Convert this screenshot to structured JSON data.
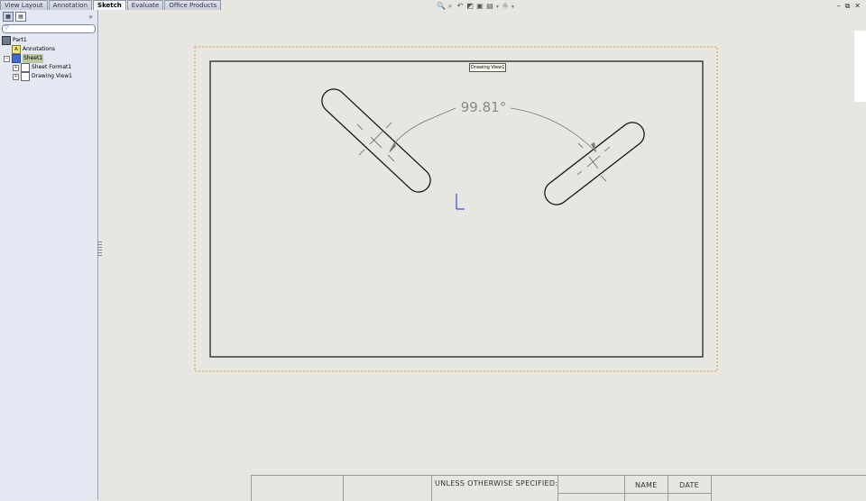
{
  "tabs": [
    "View Layout",
    "Annotation",
    "Sketch",
    "Evaluate",
    "Office Products"
  ],
  "active_tab": "Sketch",
  "view_toolbar_icons": [
    "zoom-to-fit-icon",
    "zoom-area-icon",
    "previous-view-icon",
    "section-view-icon",
    "view-orientation-icon",
    "display-style-icon",
    "hide-show-icon"
  ],
  "tree": {
    "root": "Part1",
    "annotations": "Annotations",
    "sheet": "Sheet1",
    "sheet_format": "Sheet Format1",
    "drawing_view": "Drawing View1"
  },
  "drawing": {
    "view_label": "Drawing View1",
    "angle_dimension": "99.81°"
  },
  "title_block": {
    "unless": "UNLESS OTHERWISE SPECIFIED:",
    "name": "NAME",
    "date": "DATE"
  },
  "colors": {
    "canvas": "#e7e6e0",
    "panel": "#e4e8f2",
    "border_dotted": "#e0a040",
    "origin": "#1030c0"
  }
}
